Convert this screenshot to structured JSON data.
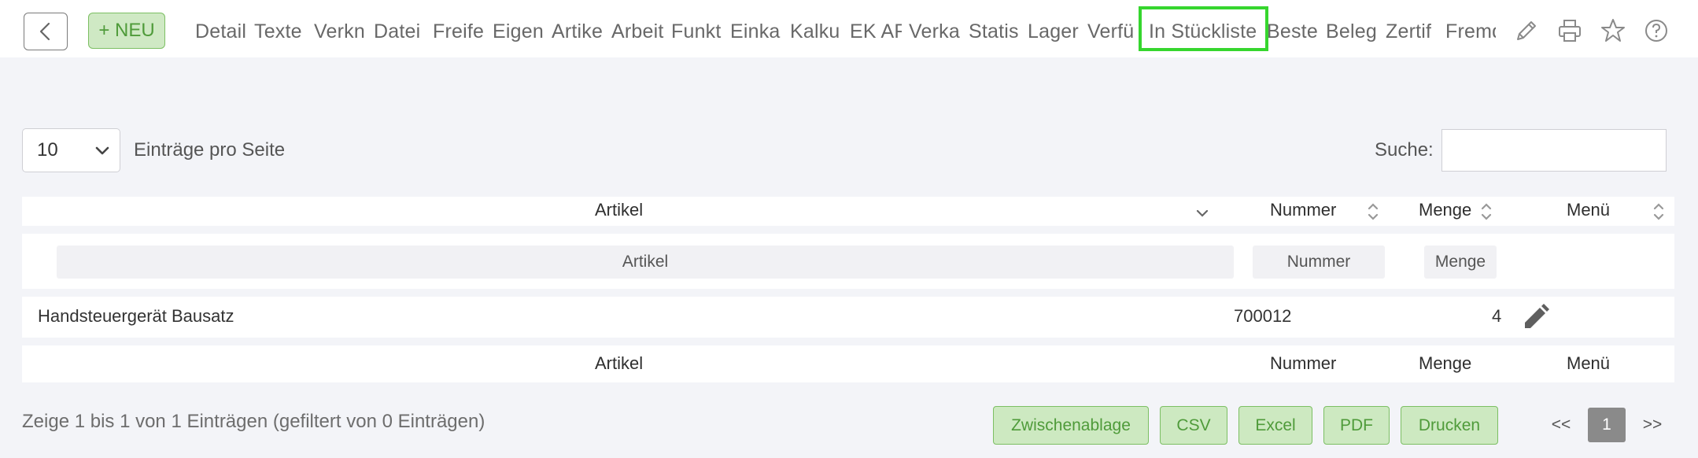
{
  "toolbar": {
    "new_label": "+ NEU",
    "tabs": [
      "Detail",
      "Texte",
      "Verkn",
      "Datei",
      "Freife",
      "Eigen",
      "Artike",
      "Arbeit",
      "Funkt",
      "Einka",
      "Kalku",
      "EK AF",
      "Verka",
      "Statis",
      "Lager",
      "Verfü",
      "In Stückliste",
      "Beste",
      "Beleg",
      "Zertif",
      "Fremd"
    ],
    "active_tab": "In Stückliste",
    "accent_color": "#36d62e"
  },
  "controls": {
    "page_size": "10",
    "entries_label": "Einträge pro Seite",
    "search_label": "Suche:",
    "search_value": ""
  },
  "table": {
    "columns": [
      "Artikel",
      "Nummer",
      "Menge",
      "Menü"
    ],
    "filters": {
      "artikel": "Artikel",
      "nummer": "Nummer",
      "menge": "Menge"
    },
    "rows": [
      {
        "artikel": "Handsteuergerät Bausatz",
        "nummer": "700012",
        "menge": "4"
      }
    ]
  },
  "footer": {
    "info": "Zeige 1 bis 1 von 1 Einträgen (gefiltert von 0 Einträgen)",
    "export_buttons": [
      "Zwischenablage",
      "CSV",
      "Excel",
      "PDF",
      "Drucken"
    ],
    "pagination": {
      "prev": "<<",
      "current": "1",
      "next": ">>"
    }
  }
}
